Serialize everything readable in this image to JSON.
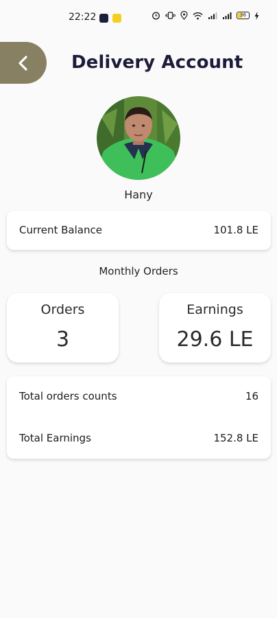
{
  "status_bar": {
    "time": "22:22",
    "battery": "36",
    "icons": [
      "app-icon-dark",
      "app-icon-yellow",
      "alarm-icon",
      "vibrate-icon",
      "location-icon",
      "wifi-icon",
      "signal-icon",
      "signal-icon",
      "battery-icon"
    ]
  },
  "header": {
    "back_icon": "chevron-left-icon",
    "title": "Delivery Account"
  },
  "profile": {
    "name": "Hany"
  },
  "balance": {
    "label": "Current Balance",
    "value": "101.8 LE"
  },
  "monthly": {
    "title": "Monthly Orders",
    "orders_label": "Orders",
    "orders_value": "3",
    "earnings_label": "Earnings",
    "earnings_value": "29.6 LE"
  },
  "totals": {
    "orders_label": "Total orders counts",
    "orders_value": "16",
    "earnings_label": "Total Earnings",
    "earnings_value": "152.8 LE"
  },
  "colors": {
    "back_button": "#878063",
    "title": "#1c1c3a",
    "background": "#fafafa",
    "card": "#ffffff"
  }
}
